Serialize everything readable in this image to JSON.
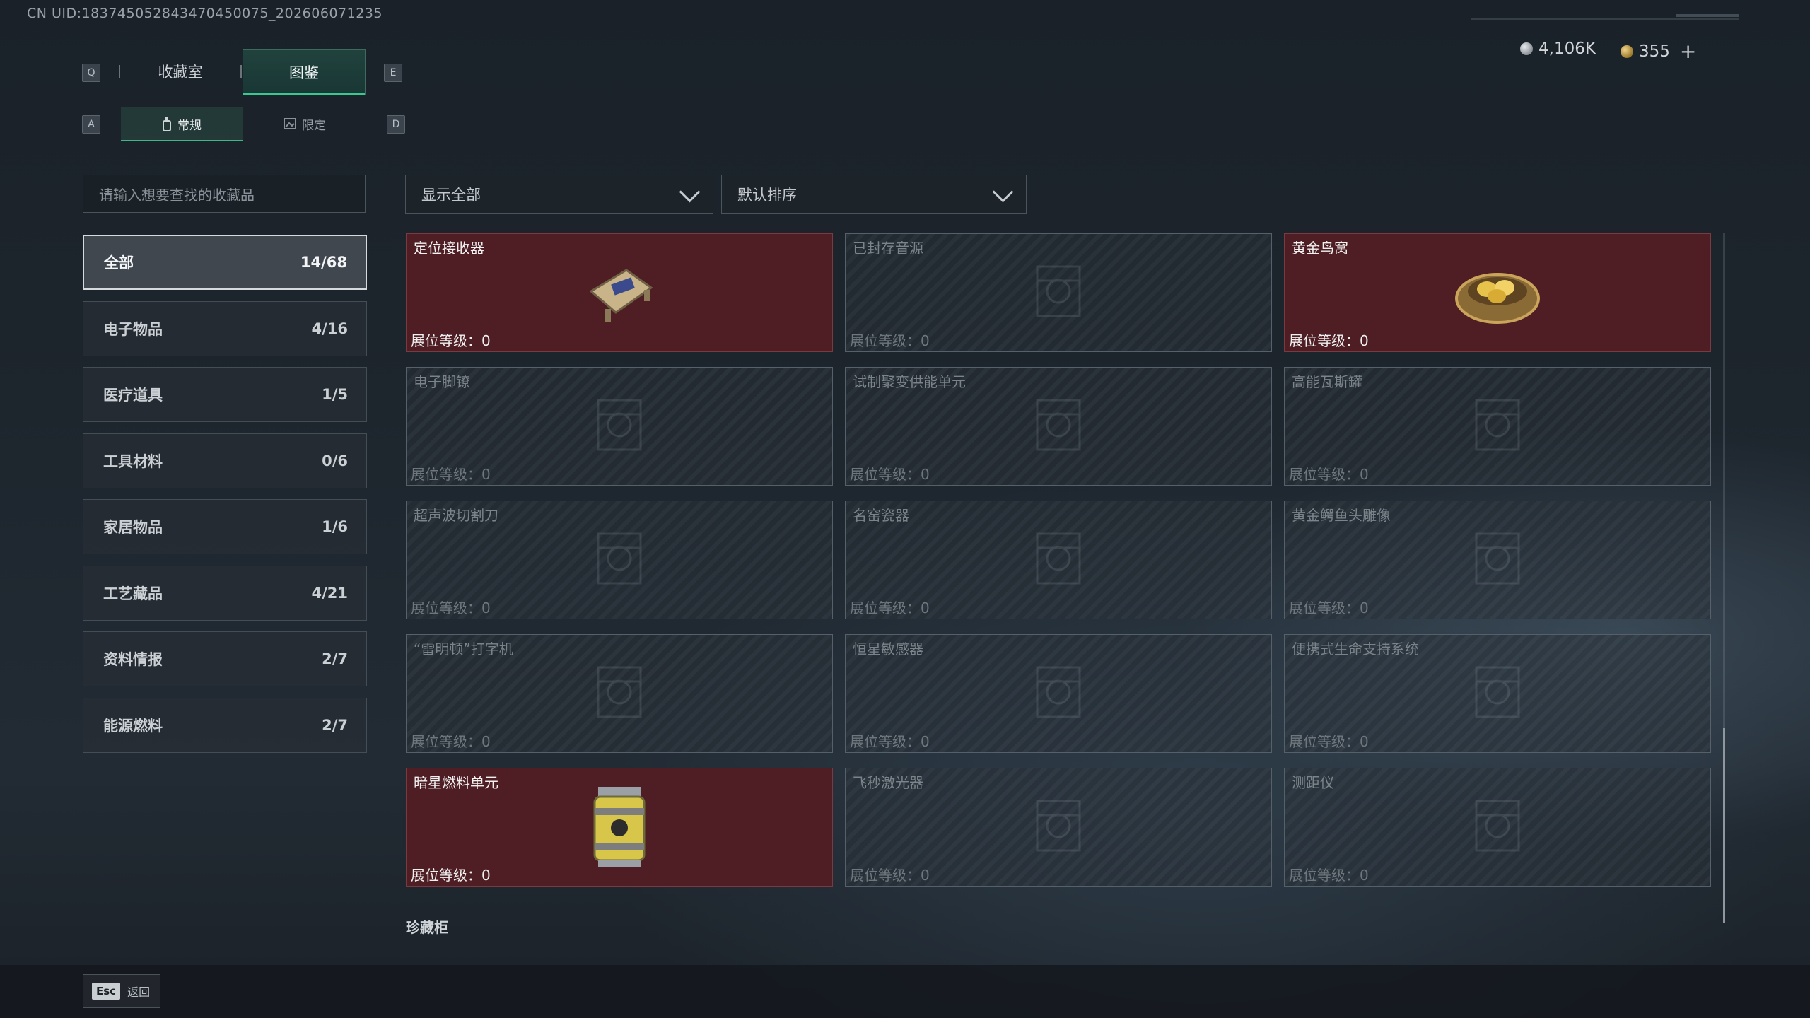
{
  "header": {
    "uid_text": "CN UID:18374505284347045​0075_202606071235",
    "currency_silver": "4,106K",
    "currency_gold": "355",
    "currency_add": "+"
  },
  "tabs": {
    "key_left": "Q",
    "key_right": "E",
    "items": [
      {
        "label": "收藏室",
        "active": false
      },
      {
        "label": "图鉴",
        "active": true
      }
    ]
  },
  "subtabs": {
    "key_left": "A",
    "key_right": "D",
    "items": [
      {
        "label": "常规",
        "active": true
      },
      {
        "label": "限定",
        "active": false
      }
    ]
  },
  "search": {
    "placeholder": "请输入想要查找的收藏品"
  },
  "filters": {
    "show": "显示全部",
    "sort": "默认排序"
  },
  "categories": [
    {
      "label": "全部",
      "count": "14/68",
      "active": true
    },
    {
      "label": "电子物品",
      "count": "4/16"
    },
    {
      "label": "医疗道具",
      "count": "1/5"
    },
    {
      "label": "工具材料",
      "count": "0/6"
    },
    {
      "label": "家居物品",
      "count": "1/6"
    },
    {
      "label": "工艺藏品",
      "count": "4/21"
    },
    {
      "label": "资料情报",
      "count": "2/7"
    },
    {
      "label": "能源燃料",
      "count": "2/7"
    }
  ],
  "items": [
    {
      "name": "定位接收器",
      "level": "展位等级：0",
      "owned": true,
      "icon": "receiver-icon"
    },
    {
      "name": "已封存音源",
      "level": "展位等级：0",
      "owned": false,
      "icon": "sound-source-icon"
    },
    {
      "name": "黄金鸟窝",
      "level": "展位等级：0",
      "owned": true,
      "icon": "golden-nest-icon"
    },
    {
      "name": "电子脚镣",
      "level": "展位等级：0",
      "owned": false,
      "icon": "ankle-monitor-icon"
    },
    {
      "name": "试制聚变供能单元",
      "level": "展位等级：0",
      "owned": false,
      "icon": "fusion-unit-icon"
    },
    {
      "name": "高能瓦斯罐",
      "level": "展位等级：0",
      "owned": false,
      "icon": "gas-canister-icon"
    },
    {
      "name": "超声波切割刀",
      "level": "展位等级：0",
      "owned": false,
      "icon": "ultrasonic-cutter-icon"
    },
    {
      "name": "名窑瓷器",
      "level": "展位等级：0",
      "owned": false,
      "icon": "porcelain-vase-icon"
    },
    {
      "name": "黄金鳄鱼头雕像",
      "level": "展位等级：0",
      "owned": false,
      "icon": "crocodile-statue-icon"
    },
    {
      "name": "“雷明顿”打字机",
      "level": "展位等级：0",
      "owned": false,
      "icon": "typewriter-icon"
    },
    {
      "name": "恒星敏感器",
      "level": "展位等级：0",
      "owned": false,
      "icon": "star-sensor-icon"
    },
    {
      "name": "便携式生命支持系统",
      "level": "展位等级：0",
      "owned": false,
      "icon": "life-support-icon"
    },
    {
      "name": "暗星燃料单元",
      "level": "展位等级：0",
      "owned": true,
      "icon": "fuel-cell-icon"
    },
    {
      "name": "飞秒激光器",
      "level": "展位等级：0",
      "owned": false,
      "icon": "laser-icon"
    },
    {
      "name": "测距仪",
      "level": "展位等级：0",
      "owned": false,
      "icon": "rangefinder-icon"
    }
  ],
  "section_next": "珍藏柜",
  "footer": {
    "esc_key": "Esc",
    "esc_label": "返回"
  }
}
